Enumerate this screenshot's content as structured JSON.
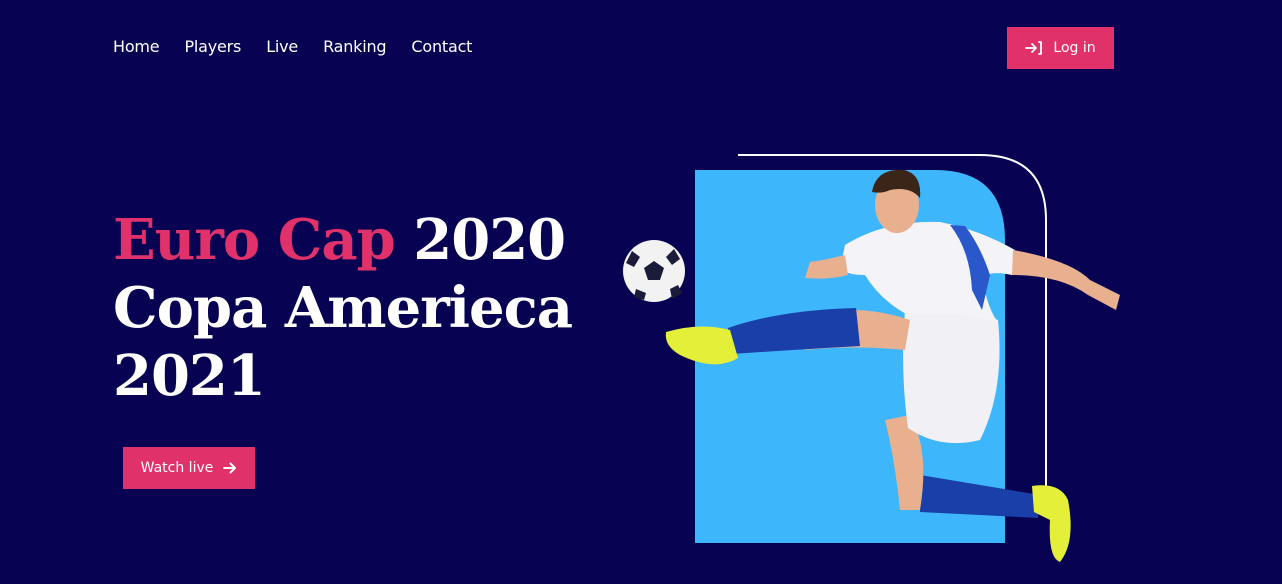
{
  "nav": {
    "items": [
      {
        "label": "Home"
      },
      {
        "label": "Players"
      },
      {
        "label": "Live"
      },
      {
        "label": "Ranking"
      },
      {
        "label": "Contact"
      }
    ],
    "login_label": "Log in",
    "login_icon": "login-icon"
  },
  "hero": {
    "title_accent": "Euro Cap",
    "title_rest": "2020",
    "title_line2": "Copa Amerieca",
    "title_line3": "2021",
    "cta_label": "Watch live",
    "cta_icon": "arrow-right-icon"
  },
  "colors": {
    "background": "#070352",
    "accent": "#e0316a",
    "panel": "#3eb6fb",
    "text": "#ffffff"
  }
}
